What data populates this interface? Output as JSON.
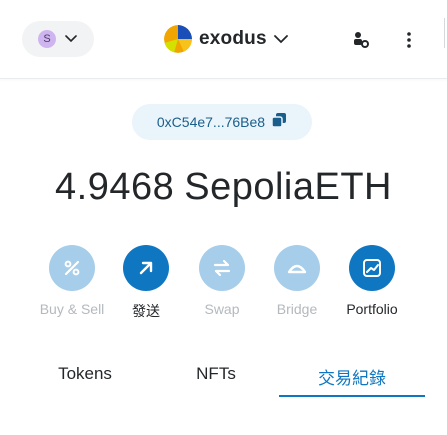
{
  "header": {
    "network": {
      "avatar_letter": "S",
      "avatar_color": "#cfb5f0"
    },
    "account": {
      "name": "exodus",
      "avatar_icon": "account-identicon"
    },
    "connect_icon": "connected-sites-icon",
    "menu_icon": "more-vertical-icon"
  },
  "address": {
    "short": "0xC54e7...76Be8",
    "copy_icon": "copy-icon"
  },
  "balance": {
    "amount": "4.9468",
    "unit": "SepoliaETH"
  },
  "actions": [
    {
      "label": "Buy & Sell",
      "icon": "buy-sell-icon",
      "enabled": false
    },
    {
      "label": "發送",
      "icon": "send-arrow-icon",
      "enabled": true
    },
    {
      "label": "Swap",
      "icon": "swap-icon",
      "enabled": false
    },
    {
      "label": "Bridge",
      "icon": "bridge-icon",
      "enabled": false
    },
    {
      "label": "Portfolio",
      "icon": "portfolio-chart-icon",
      "enabled": true
    }
  ],
  "tabs": [
    {
      "label": "Tokens",
      "active": false
    },
    {
      "label": "NFTs",
      "active": false
    },
    {
      "label": "交易紀錄",
      "active": true
    }
  ],
  "colors": {
    "primary": "#0f77c2",
    "primary_disabled": "#a6cde9",
    "address_chip_bg": "#eaf4fb",
    "text": "#24272a",
    "muted_text": "#b4b9be"
  }
}
